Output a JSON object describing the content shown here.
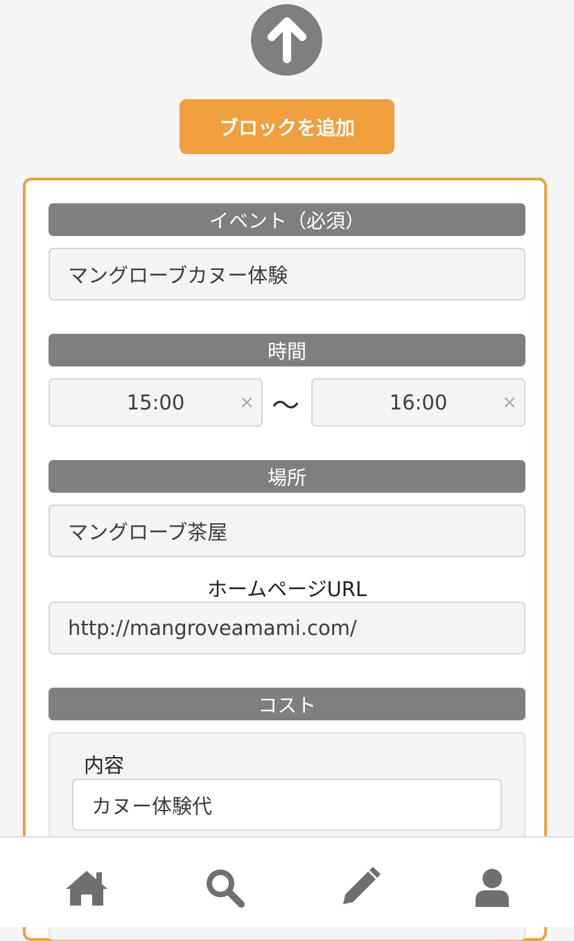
{
  "toolbar": {
    "add_block_label": "ブロックを追加"
  },
  "form": {
    "event": {
      "label": "イベント（必須）",
      "value": "マングローブカヌー体験"
    },
    "time": {
      "label": "時間",
      "start": "15:00",
      "end": "16:00",
      "separator": "〜",
      "clear_glyph": "×"
    },
    "place": {
      "label": "場所",
      "value": "マングローブ茶屋"
    },
    "homepage": {
      "label": "ホームページURL",
      "value": "http://mangroveamami.com/"
    },
    "cost": {
      "label": "コスト",
      "content_label": "内容",
      "content_value": "カヌー体験代"
    }
  },
  "nav": {
    "items": [
      {
        "icon": "home-icon"
      },
      {
        "icon": "search-icon"
      },
      {
        "icon": "pencil-icon"
      },
      {
        "icon": "user-icon"
      }
    ]
  },
  "colors": {
    "accent": "#ef9f3d",
    "label_bg": "#7f7f7f",
    "icon": "#6f6f6f"
  }
}
